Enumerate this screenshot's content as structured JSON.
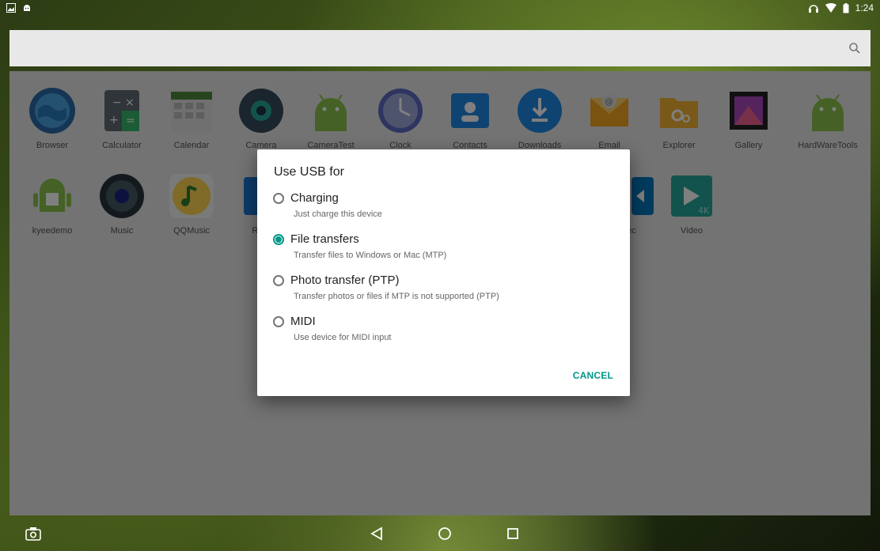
{
  "status_bar": {
    "time": "1:24"
  },
  "search": {
    "icon": "search-icon"
  },
  "apps_row1": [
    "Browser",
    "Calculator",
    "Calendar",
    "Camera",
    "CameraTest",
    "Clock",
    "Contacts",
    "Downloads",
    "Email",
    "Explorer",
    "Gallery",
    "HardWareTools"
  ],
  "apps_row2": [
    "kyeedemo",
    "Music",
    "QQMusic",
    "Root",
    "",
    "",
    "",
    "",
    "ec",
    "Video"
  ],
  "dialog": {
    "title": "Use USB for",
    "options": [
      {
        "label": "Charging",
        "sub": "Just charge this device",
        "checked": false
      },
      {
        "label": "File transfers",
        "sub": "Transfer files to Windows or Mac (MTP)",
        "checked": true
      },
      {
        "label": "Photo transfer (PTP)",
        "sub": "Transfer photos or files if MTP is not supported (PTP)",
        "checked": false
      },
      {
        "label": "MIDI",
        "sub": "Use device for MIDI input",
        "checked": false
      }
    ],
    "cancel": "CANCEL"
  },
  "colors": {
    "accent": "#009688",
    "drawer_bg": "#e6e6e6"
  }
}
